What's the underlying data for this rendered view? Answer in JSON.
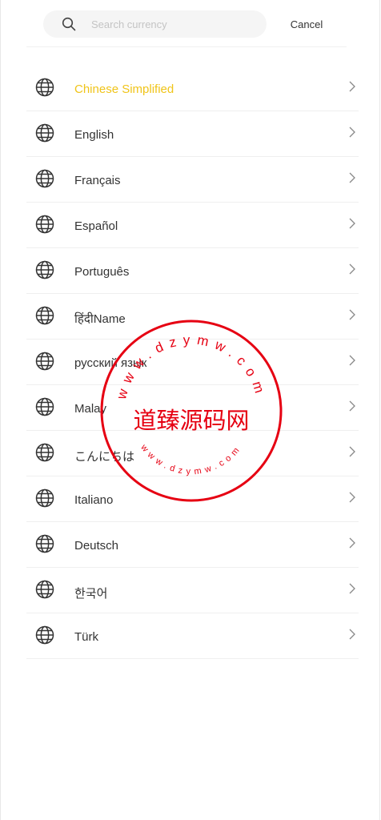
{
  "search": {
    "placeholder": "Search currency",
    "value": ""
  },
  "cancel_label": "Cancel",
  "languages": [
    {
      "label": "Chinese Simplified",
      "selected": true
    },
    {
      "label": "English"
    },
    {
      "label": "Français"
    },
    {
      "label": "Español"
    },
    {
      "label": "Português"
    },
    {
      "label": "हिंदीName"
    },
    {
      "label": "русский язык"
    },
    {
      "label": "Malay"
    },
    {
      "label": "こんにちは"
    },
    {
      "label": "Italiano"
    },
    {
      "label": "Deutsch"
    },
    {
      "label": "한국어"
    },
    {
      "label": "Türk"
    }
  ],
  "watermark": {
    "title": "道臻源码网",
    "url": "www.dzymw.com"
  },
  "colors": {
    "accent": "#f0c419",
    "text": "#333333",
    "stamp": "#e60012"
  }
}
